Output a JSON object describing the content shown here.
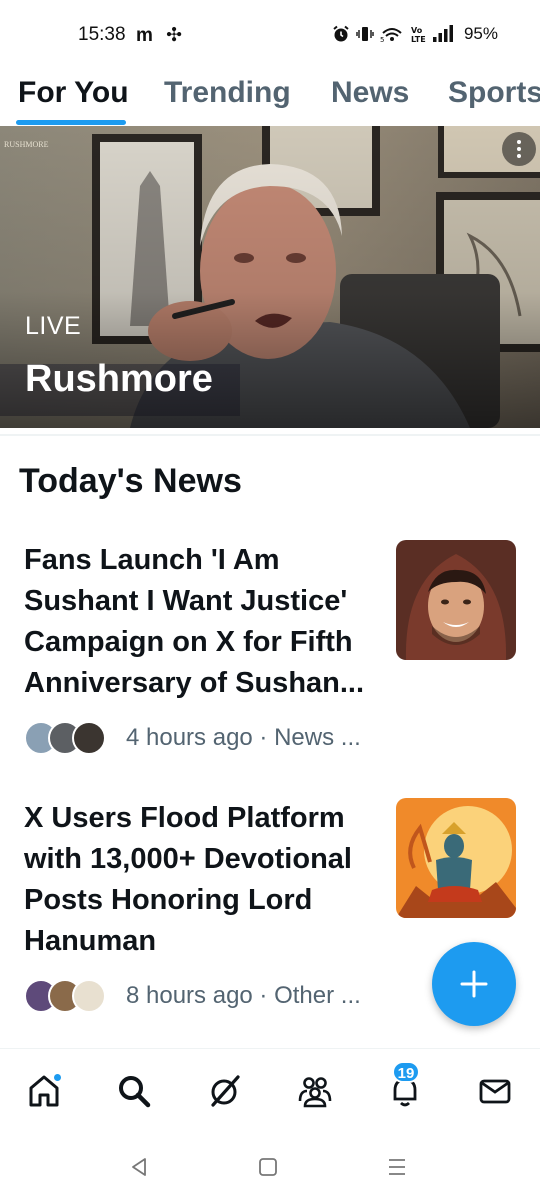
{
  "status_bar": {
    "time": "15:38",
    "left_icons": "m ✣",
    "battery": "95%",
    "icons": [
      "alarm-icon",
      "vibrate-icon",
      "wifi-icon",
      "volte-icon",
      "signal-icon"
    ]
  },
  "tabs": [
    {
      "label": "For You",
      "active": true
    },
    {
      "label": "Trending",
      "active": false
    },
    {
      "label": "News",
      "active": false
    },
    {
      "label": "Sports",
      "active": false
    }
  ],
  "hero": {
    "badge": "LIVE",
    "title": "Rushmore",
    "logo_text": "RUSHMORE"
  },
  "section_title": "Today's News",
  "news": [
    {
      "headline": "Fans Launch 'I Am Sushant I Want Justice' Campaign on X for Fifth Anniversary of Sushan...",
      "meta": "4 hours ago · News ...",
      "thumb": "portrait-hooded-man"
    },
    {
      "headline": "X Users Flood Platform with 13,000+ Devotional Posts Honoring Lord Hanuman",
      "meta": "8 hours ago · Other ...",
      "thumb": "hanuman-illustration"
    }
  ],
  "fab_icon": "plus-icon",
  "bottom_nav": {
    "items": [
      "home-icon",
      "search-icon",
      "grok-icon",
      "communities-icon",
      "notifications-icon",
      "messages-icon"
    ],
    "notifications_badge": "19"
  },
  "colors": {
    "accent": "#1d9bf0",
    "text_primary": "#0f1419",
    "text_secondary": "#536471"
  }
}
